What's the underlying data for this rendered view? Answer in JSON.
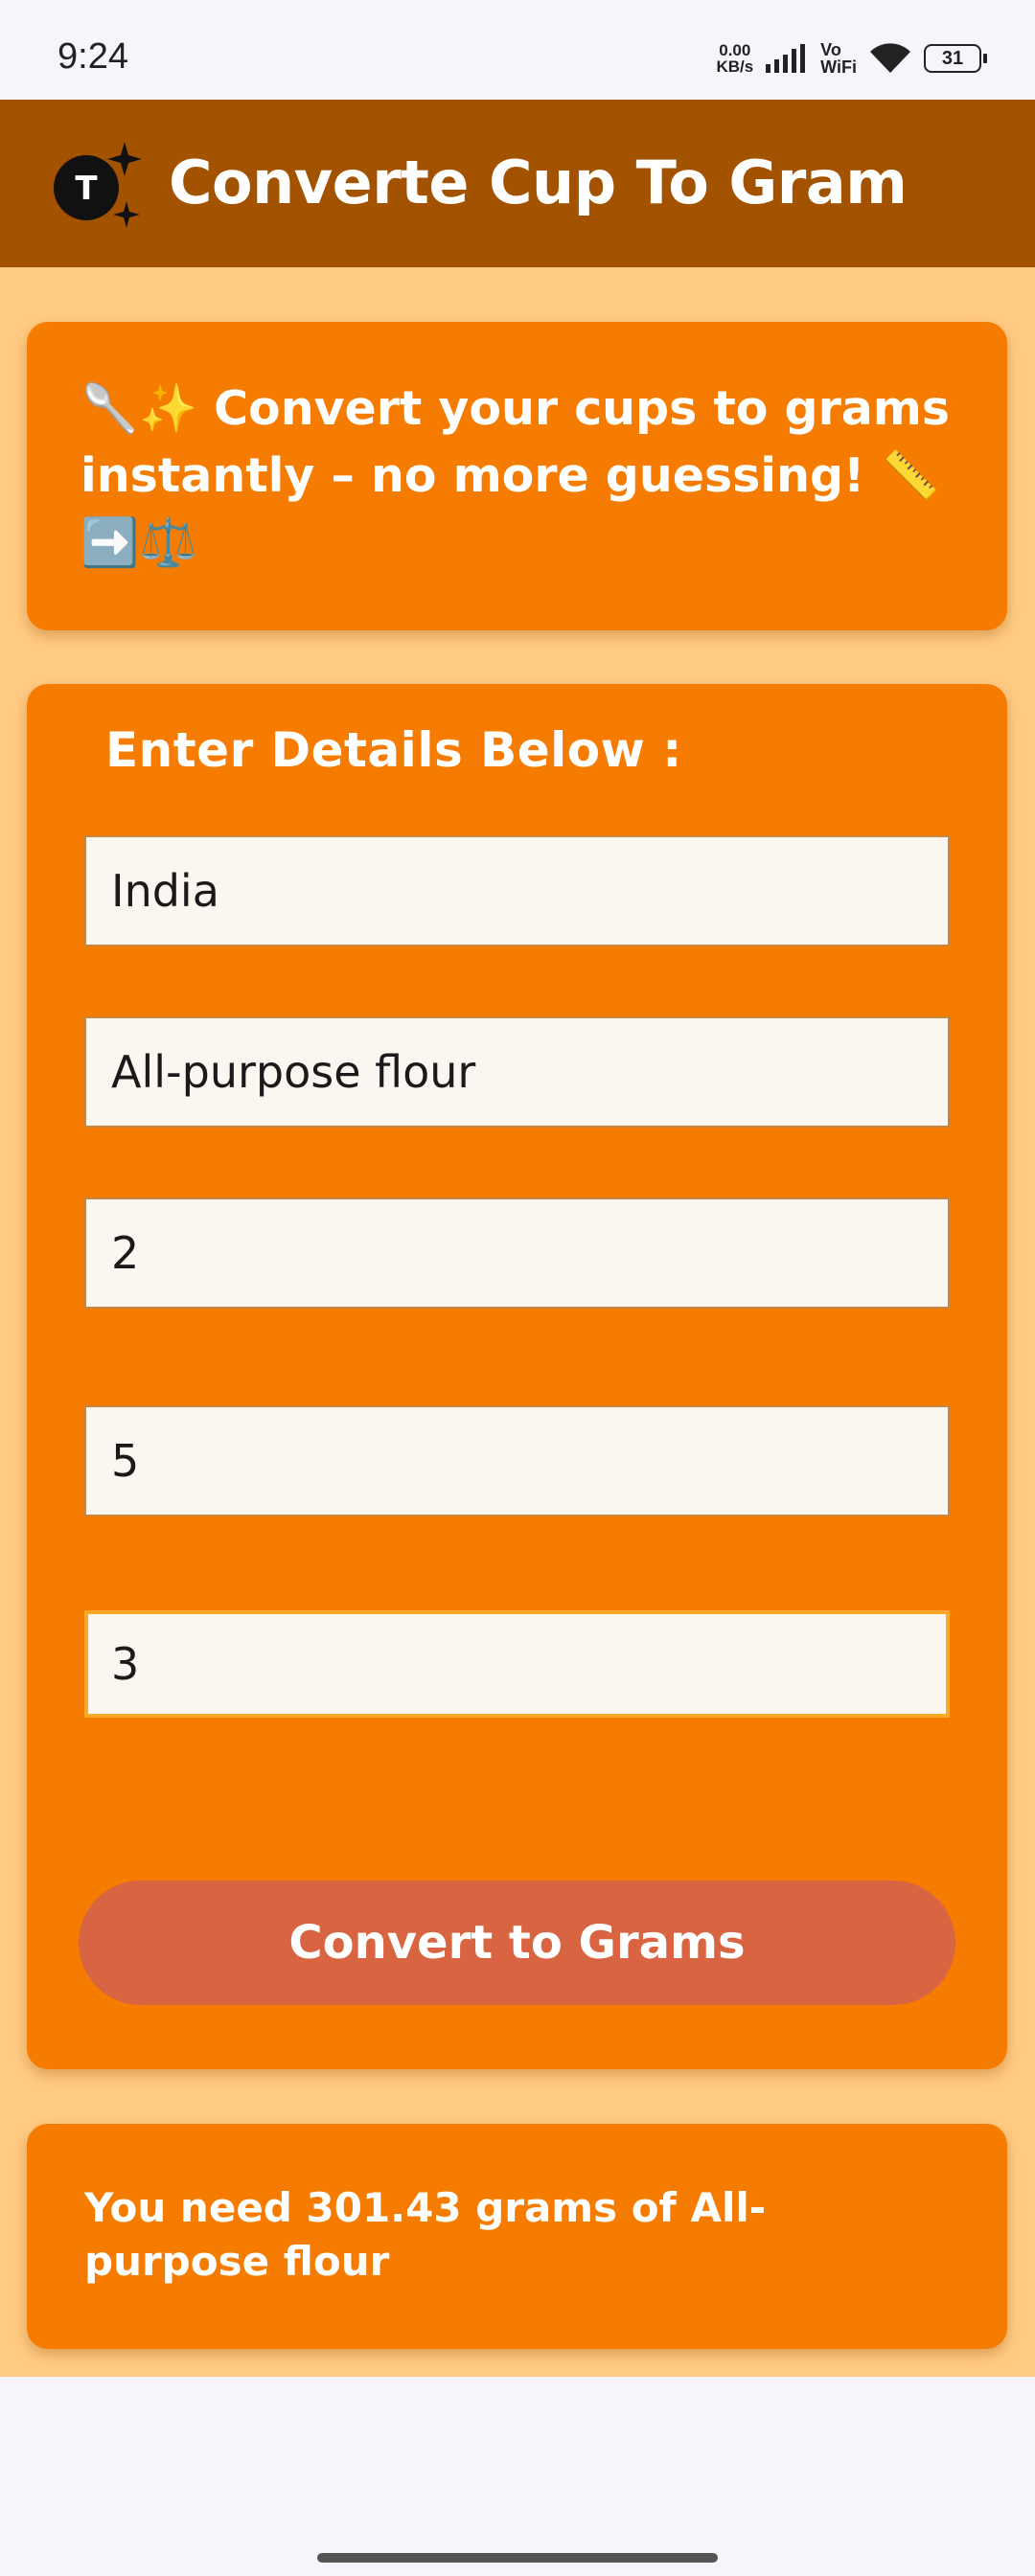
{
  "status_bar": {
    "time": "9:24",
    "net_speed_value": "0.00",
    "net_speed_unit": "KB/s",
    "vowifi_top": "Vo",
    "vowifi_bottom": "WiFi",
    "battery": "31"
  },
  "app_bar": {
    "logo_letter": "T",
    "title": "Converte Cup To Gram"
  },
  "intro": {
    "text": "🥄✨ Convert your cups to grams instantly – no more guessing! 📏➡️⚖️"
  },
  "form": {
    "heading": "Enter Details Below :",
    "fields": [
      {
        "value": "India"
      },
      {
        "value": "All-purpose flour"
      },
      {
        "value": "2"
      },
      {
        "value": "5"
      },
      {
        "value": "3"
      }
    ],
    "button_label": "Convert to Grams"
  },
  "result": {
    "text": "You need 301.43 grams of All-purpose flour"
  },
  "colors": {
    "app_bar": "#a35200",
    "background": "#ffcb84",
    "card": "#f57c00",
    "button": "#d96441",
    "field": "#fcf6f0"
  }
}
